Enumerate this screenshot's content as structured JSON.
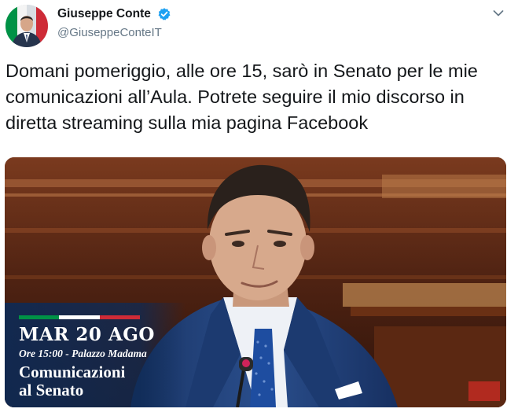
{
  "author": {
    "display_name": "Giuseppe Conte",
    "handle": "@GiuseppeConteIT",
    "verified": true,
    "avatar": "portrait-with-italian-flag"
  },
  "tweet": {
    "text": "Domani pomeriggio, alle ore 15, sarò in Senato per le mie comunicazioni all’Aula. Potrete seguire il mio discorso in diretta streaming sulla mia pagina Facebook"
  },
  "media": {
    "date": "MAR 20 AGO",
    "subtitle": "Ore 15:00 - Palazzo Madama",
    "title_line1": "Comunicazioni",
    "title_line2": "al Senato"
  },
  "colors": {
    "verified": "#1da1f2",
    "flag_green": "#009246",
    "flag_white": "#ffffff",
    "flag_red": "#ce2b37",
    "overlay": "#0e2a55",
    "suit": "#1f3d73",
    "text": "#14171a",
    "muted": "#657786"
  },
  "icons": {
    "verified": "verified-badge-icon",
    "caret": "chevron-down-icon"
  }
}
